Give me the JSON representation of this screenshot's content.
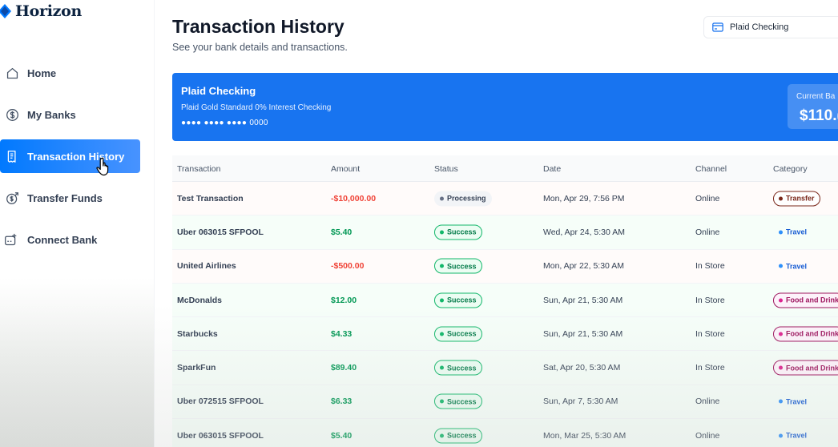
{
  "app": {
    "name": "Horizon"
  },
  "sidebar": {
    "items": [
      {
        "label": "Home",
        "icon": "home-icon",
        "active": false
      },
      {
        "label": "My Banks",
        "icon": "dollar-circle-icon",
        "active": false
      },
      {
        "label": "Transaction History",
        "icon": "receipt-icon",
        "active": true
      },
      {
        "label": "Transfer Funds",
        "icon": "money-send-icon",
        "active": false
      },
      {
        "label": "Connect Bank",
        "icon": "connect-bank-icon",
        "active": false
      }
    ]
  },
  "header": {
    "title": "Transaction History",
    "subtitle": "See your bank details and transactions.",
    "account_select": "Plaid Checking"
  },
  "bank_card": {
    "name": "Plaid Checking",
    "official_name": "Plaid Gold Standard 0% Interest Checking",
    "mask": "●●●● ●●●● ●●●● 0000",
    "balance_label": "Current Ba",
    "balance_value": "$110.("
  },
  "table": {
    "columns": [
      "Transaction",
      "Amount",
      "Status",
      "Date",
      "Channel",
      "Category"
    ],
    "rows": [
      {
        "name": "Test Transaction",
        "amount": "-$10,000.00",
        "type": "debit",
        "status": "Processing",
        "date": "Mon, Apr 29, 7:56 PM",
        "channel": "Online",
        "category": "Transfer"
      },
      {
        "name": "Uber 063015 SFPOOL",
        "amount": "$5.40",
        "type": "credit",
        "status": "Success",
        "date": "Wed, Apr 24, 5:30 AM",
        "channel": "Online",
        "category": "Travel"
      },
      {
        "name": "United Airlines",
        "amount": "-$500.00",
        "type": "debit",
        "status": "Success",
        "date": "Mon, Apr 22, 5:30 AM",
        "channel": "In Store",
        "category": "Travel"
      },
      {
        "name": "McDonalds",
        "amount": "$12.00",
        "type": "credit",
        "status": "Success",
        "date": "Sun, Apr 21, 5:30 AM",
        "channel": "In Store",
        "category": "Food and Drink"
      },
      {
        "name": "Starbucks",
        "amount": "$4.33",
        "type": "credit",
        "status": "Success",
        "date": "Sun, Apr 21, 5:30 AM",
        "channel": "In Store",
        "category": "Food and Drink"
      },
      {
        "name": "SparkFun",
        "amount": "$89.40",
        "type": "credit",
        "status": "Success",
        "date": "Sat, Apr 20, 5:30 AM",
        "channel": "In Store",
        "category": "Food and Drink"
      },
      {
        "name": "Uber 072515 SFPOOL",
        "amount": "$6.33",
        "type": "credit",
        "status": "Success",
        "date": "Sun, Apr 7, 5:30 AM",
        "channel": "Online",
        "category": "Travel"
      },
      {
        "name": "Uber 063015 SFPOOL",
        "amount": "$5.40",
        "type": "credit",
        "status": "Success",
        "date": "Mon, Mar 25, 5:30 AM",
        "channel": "Online",
        "category": "Travel"
      }
    ]
  },
  "colors": {
    "accent": "#0179fe",
    "card": "#1874f0",
    "debit": "#f04438",
    "credit": "#039855",
    "success": "#12b76a",
    "food": "#9e165f",
    "transfer": "#7a271a",
    "travel": "#175cd3"
  }
}
